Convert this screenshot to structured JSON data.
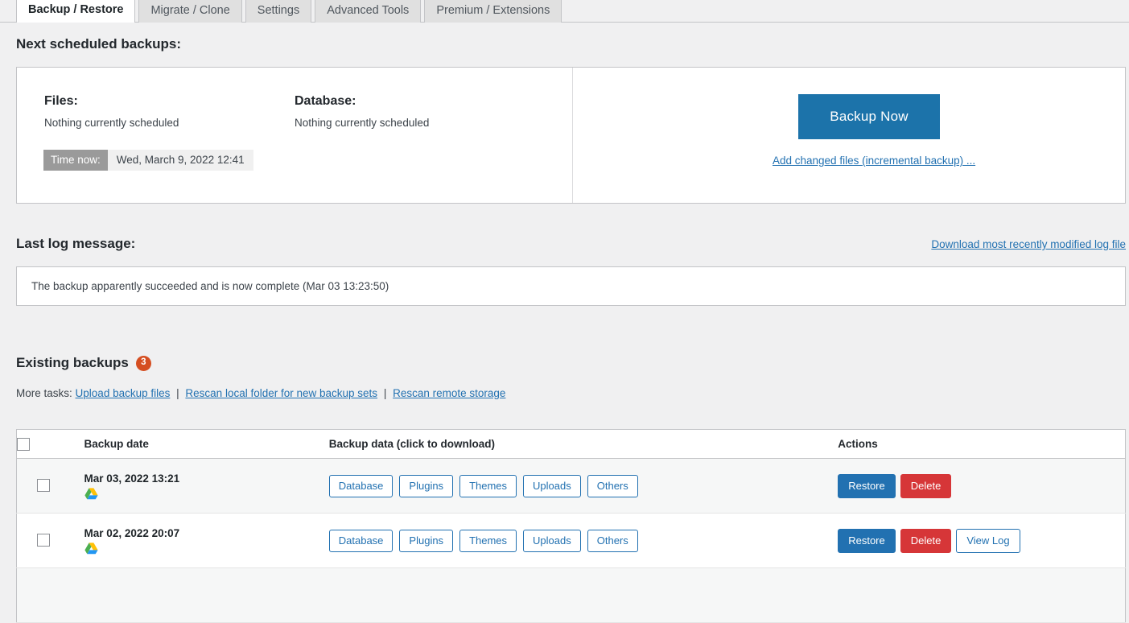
{
  "tabs": [
    {
      "label": "Backup / Restore",
      "active": true
    },
    {
      "label": "Migrate / Clone",
      "active": false
    },
    {
      "label": "Settings",
      "active": false
    },
    {
      "label": "Advanced Tools",
      "active": false
    },
    {
      "label": "Premium / Extensions",
      "active": false
    }
  ],
  "scheduled": {
    "heading": "Next scheduled backups:",
    "files_label": "Files:",
    "files_value": "Nothing currently scheduled",
    "database_label": "Database:",
    "database_value": "Nothing currently scheduled",
    "time_now_label": "Time now:",
    "time_now_value": "Wed, March 9, 2022 12:41",
    "backup_now_label": "Backup Now",
    "incremental_link": "Add changed files (incremental backup) ..."
  },
  "log": {
    "heading": "Last log message:",
    "download_link": "Download most recently modified log file",
    "message": "The backup apparently succeeded and is now complete (Mar 03 13:23:50)"
  },
  "existing": {
    "heading": "Existing backups",
    "count": "3",
    "more_tasks_label": "More tasks:",
    "tasks": [
      "Upload backup files",
      "Rescan local folder for new backup sets",
      "Rescan remote storage"
    ],
    "separator": "|"
  },
  "table": {
    "columns": {
      "date": "Backup date",
      "data": "Backup data (click to download)",
      "actions": "Actions"
    },
    "rows": [
      {
        "date": "Mar 03, 2022 13:21",
        "storage_icon": "google-drive-icon",
        "data_buttons": [
          "Database",
          "Plugins",
          "Themes",
          "Uploads",
          "Others"
        ],
        "actions": [
          {
            "label": "Restore",
            "style": "restore"
          },
          {
            "label": "Delete",
            "style": "delete"
          }
        ]
      },
      {
        "date": "Mar 02, 2022 20:07",
        "storage_icon": "google-drive-icon",
        "data_buttons": [
          "Database",
          "Plugins",
          "Themes",
          "Uploads",
          "Others"
        ],
        "actions": [
          {
            "label": "Restore",
            "style": "restore"
          },
          {
            "label": "Delete",
            "style": "delete"
          },
          {
            "label": "View Log",
            "style": "viewlog"
          }
        ]
      }
    ]
  },
  "colors": {
    "page_background": "#f0f0f1",
    "primary_blue": "#2271b1",
    "backup_now_blue": "#1c73aa",
    "delete_red": "#d63638",
    "badge_orange": "#d54e21",
    "border": "#c3c4c7"
  }
}
